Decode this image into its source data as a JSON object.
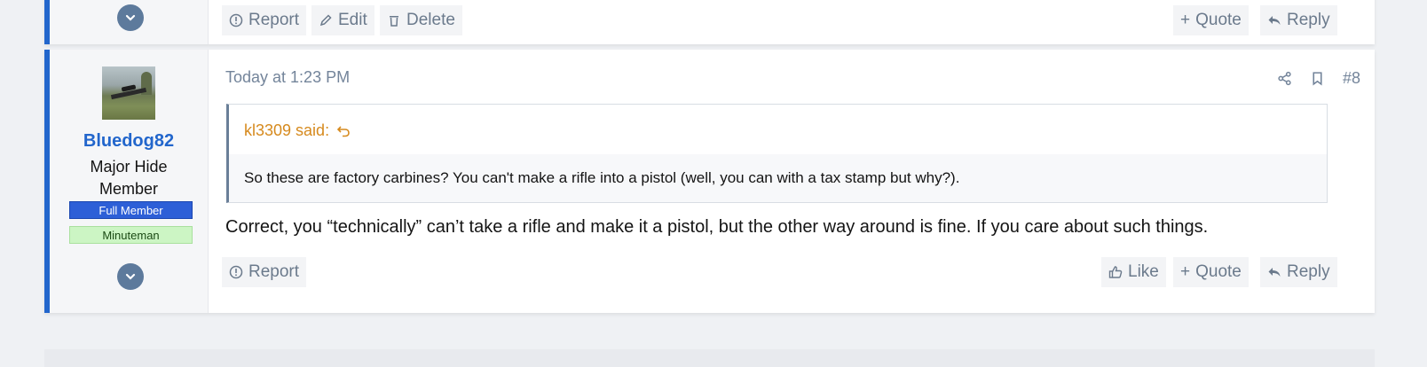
{
  "previous_post": {
    "actions_left": [
      "Report",
      "Edit",
      "Delete"
    ],
    "actions_right": [
      "Quote",
      "Reply"
    ]
  },
  "post": {
    "username": "Bluedog82",
    "user_title": "Major Hide Member",
    "banners": [
      "Full Member",
      "Minuteman"
    ],
    "date": "Today at 1:23 PM",
    "post_number": "#8",
    "quote": {
      "author": "kl3309 said:",
      "text": "So these are factory carbines? You can't make a rifle into a pistol (well, you can with a tax stamp but why?)."
    },
    "message": "Correct, you “technically” can’t take a rifle and make it a pistol, but the other way around is fine. If you care about such things.",
    "actions_left": [
      "Report"
    ],
    "actions_right": [
      "Like",
      "Quote",
      "Reply"
    ]
  },
  "colors": {
    "accent": "#2266cc",
    "username": "#2266cc",
    "quote_author": "#d68a1e",
    "banner_full_member": "#2d5fd7",
    "banner_minuteman": "#ccf5c4"
  }
}
